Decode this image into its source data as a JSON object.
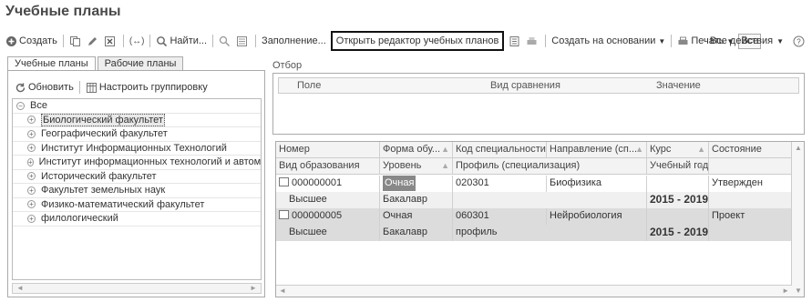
{
  "window": {
    "title": "Учебные планы"
  },
  "toolbar": {
    "create": "Создать",
    "find": "Найти...",
    "fill": "Заполнение...",
    "open_editor": "Открыть редактор учебных планов",
    "create_based_on": "Создать на основании",
    "print": "Печать",
    "all": "Все",
    "all_actions": "Все действия"
  },
  "left_panel": {
    "tabs": [
      "Учебные планы",
      "Рабочие планы"
    ],
    "refresh": "Обновить",
    "configure_grouping": "Настроить группировку",
    "tree_root": "Все",
    "tree_items": [
      "Биологический факультет",
      "Географический факультет",
      "Институт Информационных Технологий",
      "Институт информационных технологий и автомати",
      "Исторический факультет",
      "Факультет земельных наук",
      "Физико-математический факультет",
      "филологический"
    ]
  },
  "filter": {
    "legend": "Отбор",
    "columns": [
      "Поле",
      "Вид сравнения",
      "Значение"
    ]
  },
  "grid": {
    "header_row1": [
      "Номер",
      "Форма обу...",
      "Код специальности",
      "Направление (сп...",
      "Курс",
      "Состояние"
    ],
    "header_row2": [
      "Вид образования",
      "Уровень",
      "Профиль (специализация)",
      "Учебный год"
    ],
    "rows": [
      {
        "number": "000000001",
        "form": "Очная",
        "code": "020301",
        "direction": "Биофизика",
        "course": "",
        "state": "Утвержден",
        "edu_type": "Высшее",
        "level": "Бакалавр",
        "profile": "",
        "year": "2015 - 2019"
      },
      {
        "number": "000000005",
        "form": "Очная",
        "code": "060301",
        "direction": "Нейробиология",
        "course": "",
        "state": "Проект",
        "edu_type": "Высшее",
        "level": "Бакалавр",
        "profile": "профиль",
        "year": "2015 - 2019"
      }
    ]
  }
}
